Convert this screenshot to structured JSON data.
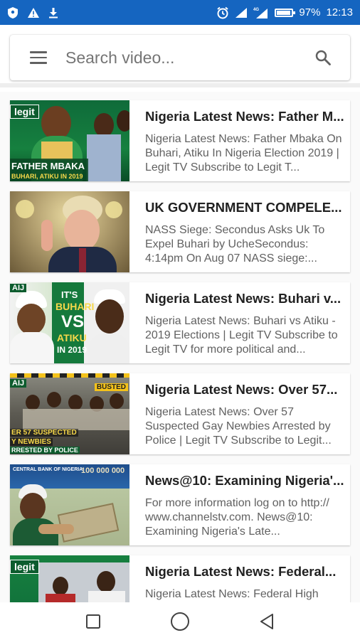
{
  "status_bar": {
    "battery": "97%",
    "time": "12:13",
    "icons": [
      "shield-icon",
      "warning-icon",
      "download-icon",
      "alarm-icon",
      "signal-icon",
      "signal-4g-icon",
      "battery-icon"
    ]
  },
  "search": {
    "placeholder": "Search video..."
  },
  "videos": [
    {
      "title": "Nigeria Latest News: Father M...",
      "description": "Nigeria Latest News: Father Mbaka On Buhari, Atiku In Nigeria Election 2019 | Legit TV Subscribe to Legit T...",
      "thumb_text": [
        "legit",
        "FATHER MBAKA",
        "BUHARI, ATIKU IN 2019"
      ]
    },
    {
      "title": "UK GOVERNMENT COMPELE...",
      "description": "NASS Siege: Secondus Asks Uk To Expel Buhari by UcheSecondus: 4:14pm On Aug 07 NASS siege:...",
      "thumb_text": []
    },
    {
      "title": "Nigeria Latest News: Buhari v...",
      "description": "Nigeria Latest News: Buhari vs Atiku - 2019 Elections | Legit TV Subscribe to Legit TV for more political and...",
      "thumb_text": [
        "AIJ",
        "IT'S",
        "BUHARI",
        "VS",
        "ATIKU",
        "IN 2019"
      ]
    },
    {
      "title": "Nigeria Latest News: Over 57...",
      "description": "Nigeria Latest News: Over 57 Suspected Gay Newbies Arrested by Police | Legit TV Subscribe to Legit...",
      "thumb_text": [
        "AIJ",
        "BUSTED",
        "ER 57 SUSPECTED",
        "Y NEWBIES",
        "RRESTED BY POLICE"
      ]
    },
    {
      "title": "News@10: Examining Nigeria'...",
      "description": "For more information log on to http:// www.channelstv.com. News@10: Examining Nigeria's Late...",
      "thumb_text": [
        "CENTRAL BANK OF NIGERIA",
        "100 000 000"
      ]
    },
    {
      "title": "Nigeria Latest News: Federal...",
      "description": "Nigeria Latest News: Federal High",
      "thumb_text": [
        "legit"
      ]
    }
  ],
  "nav": {
    "icons": [
      "recent-apps-icon",
      "home-icon",
      "back-icon"
    ]
  },
  "colors": {
    "status_bar": "#1565c0",
    "accent_green": "#0d5c2e"
  }
}
